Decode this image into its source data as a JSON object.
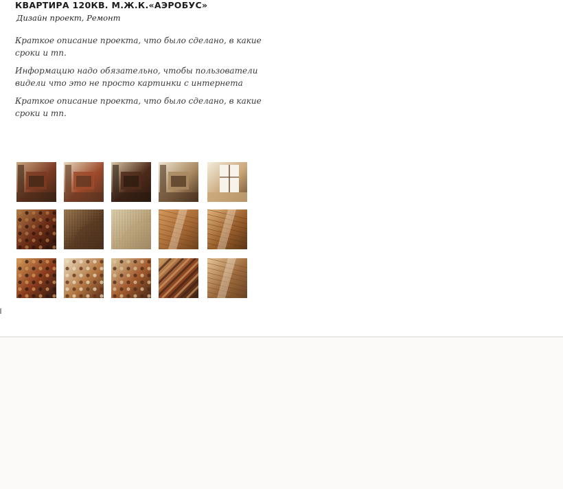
{
  "project": {
    "title": "КВАРТИРА 120КВ.  М.Ж.К.«АЭРОБУС»",
    "tags": "Дизайн проект,  Ремонт",
    "paragraphs": [
      "Краткое описание проекта, что было сделано,  в какие сроки и тп.",
      "Информацию надо обязательно, чтобы пользователи видели что это не просто картинки с интернета",
      "Краткое описание проекта, что было сделано,  в какие сроки и тп."
    ]
  },
  "gallery": {
    "rows": [
      [
        {
          "name": "thumb-fireplace-library",
          "kind": "interior",
          "colors": [
            "#7a3a22",
            "#c8a67f",
            "#3b2416"
          ]
        },
        {
          "name": "thumb-fireplace-lamp",
          "kind": "interior",
          "colors": [
            "#9c4a2a",
            "#e6d7bc",
            "#5a3320"
          ]
        },
        {
          "name": "thumb-bookshelf-table",
          "kind": "interior",
          "colors": [
            "#4d2a1a",
            "#d8c7a5",
            "#2a1a10"
          ]
        },
        {
          "name": "thumb-hallway-table",
          "kind": "interior",
          "colors": [
            "#a88860",
            "#efe4cf",
            "#4b3220"
          ]
        },
        {
          "name": "thumb-window-room",
          "kind": "window",
          "colors": [
            "#c9a678",
            "#f3ecdd",
            "#6e4d2e"
          ]
        }
      ],
      [
        {
          "name": "thumb-carpet-dark",
          "kind": "carpet",
          "colors": [
            "#6b2c17",
            "#b07845",
            "#2d140b"
          ]
        },
        {
          "name": "thumb-armchair-dark",
          "kind": "fabric",
          "colors": [
            "#5a3a22",
            "#9c7a52",
            "#2e1d12"
          ]
        },
        {
          "name": "thumb-armchair-beige",
          "kind": "fabric",
          "colors": [
            "#b9a27a",
            "#dccfac",
            "#7a6543"
          ]
        },
        {
          "name": "thumb-wood-floor",
          "kind": "wood",
          "colors": [
            "#a86a35",
            "#d59a5e",
            "#6e401c"
          ]
        },
        {
          "name": "thumb-wood-floor-window",
          "kind": "wood",
          "colors": [
            "#9a5f2c",
            "#e0b27a",
            "#5b3516"
          ]
        }
      ],
      [
        {
          "name": "thumb-carpet-pattern",
          "kind": "carpet",
          "colors": [
            "#8a3a1c",
            "#d39a5b",
            "#2b1a12"
          ]
        },
        {
          "name": "thumb-carpet-cream",
          "kind": "carpet",
          "colors": [
            "#b57a45",
            "#eadcc2",
            "#5e2f18"
          ]
        },
        {
          "name": "thumb-carpet-chair",
          "kind": "carpet",
          "colors": [
            "#a35a2d",
            "#d9c39a",
            "#4a2a18"
          ]
        },
        {
          "name": "thumb-runner-rug",
          "kind": "rug",
          "colors": [
            "#8e3f1f",
            "#c99a62",
            "#3a2416"
          ]
        },
        {
          "name": "thumb-glossy-floor",
          "kind": "wood",
          "colors": [
            "#9d6a3c",
            "#e8c596",
            "#6a4322"
          ]
        }
      ]
    ]
  },
  "colors": {
    "title": "#1c1c1c",
    "text": "#3a3a3a",
    "footer_bg": "#fbfaf8",
    "divider": "#d9d7d3"
  }
}
